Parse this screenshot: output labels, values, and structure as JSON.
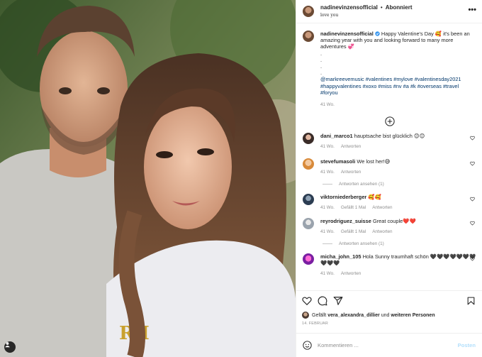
{
  "header": {
    "username": "nadinevinzensofficial",
    "separator": "•",
    "follow_state": "Abonniert",
    "subtitle": "love you",
    "more": "•••"
  },
  "caption": {
    "username": "nadinevinzensofficial",
    "text_start": "Happy Valentine's Day ",
    "emoji_1": "🥰",
    "text_mid": " it's been an amazing year with you and looking forward to many more adventures ",
    "emoji_2": "💞",
    "dots": [
      ".",
      ".",
      ".",
      "."
    ],
    "mention": "@markreevemusic",
    "hashtags": "#valentines #mylove #valentinesday2021 #happyvalentines #xoxo #miss #nv #a #k #overseas #travel #foryou",
    "age": "41 Wo."
  },
  "comments": [
    {
      "username": "dani_marco1",
      "text": "hauptsache bist glücklich 😊😊",
      "age": "41 Wo.",
      "likes": "",
      "reply": "Antworten",
      "view_replies": ""
    },
    {
      "username": "stevefumasoli",
      "text": "We lost her!😅",
      "age": "41 Wo.",
      "likes": "",
      "reply": "Antworten",
      "view_replies": "Antworten ansehen (1)"
    },
    {
      "username": "viktorniederberger",
      "text": "🥰🥰",
      "age": "41 Wo.",
      "likes": "Gefällt 1 Mal",
      "reply": "Antworten",
      "view_replies": ""
    },
    {
      "username": "reyrodriguez_suisse",
      "text": "Great couple❤️❤️",
      "age": "41 Wo.",
      "likes": "Gefällt 1 Mal",
      "reply": "Antworten",
      "view_replies": "Antworten ansehen (1)"
    },
    {
      "username": "micha_john_105",
      "text": "Hola Sunny traumhaft schön 🖤🖤🖤🖤🖤🖤🖤🖤🖤🖤",
      "age": "41 Wo.",
      "likes": "",
      "reply": "Antworten",
      "view_replies": ""
    }
  ],
  "likes_line": {
    "prefix": "Gefällt ",
    "user": "vera_alexandra_dillier",
    "middle": " und ",
    "others": "weiteren Personen"
  },
  "date": "14. FEBRUAR",
  "add_comment": {
    "placeholder": "Kommentieren ...",
    "post_label": "Posten"
  },
  "colors": {
    "link_blue": "#00376b",
    "post_button": "#b2dffc",
    "muted": "#8e8e8e",
    "border": "#efefef",
    "text": "#262626"
  },
  "icons": [
    "heart-icon",
    "comment-icon",
    "share-icon",
    "bookmark-icon",
    "emoji-icon",
    "plus-circle-icon",
    "more-icon",
    "user-tag-icon"
  ]
}
